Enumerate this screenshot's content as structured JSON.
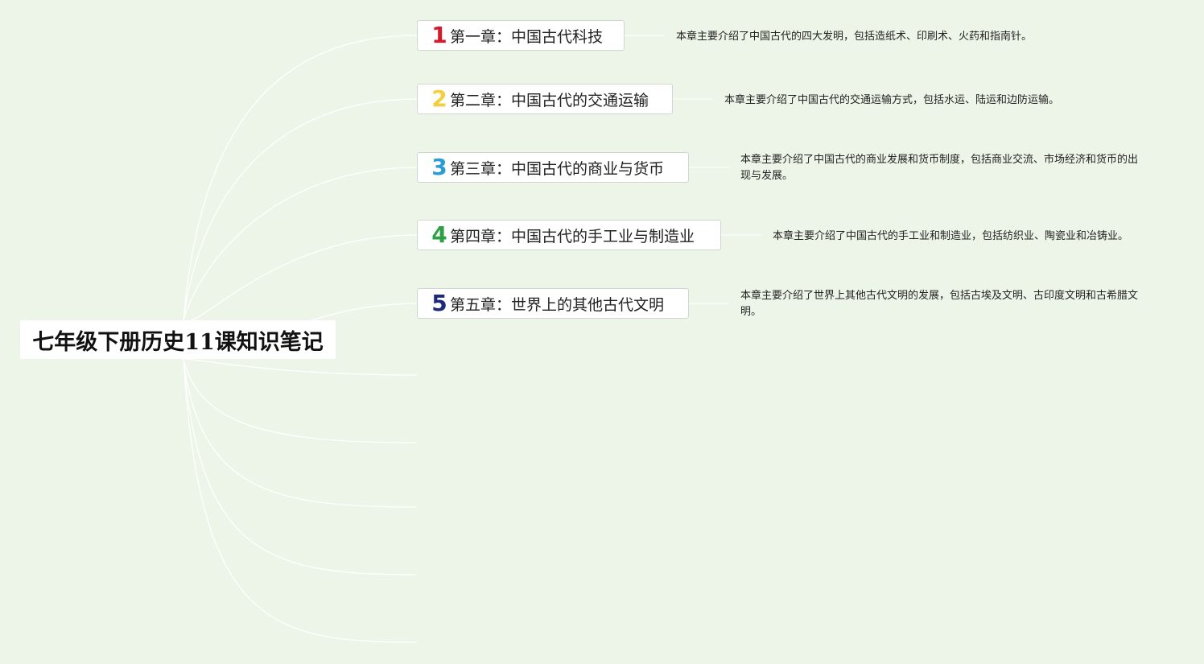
{
  "root": {
    "title": "七年级下册历史11课知识笔记"
  },
  "chapters": [
    {
      "number": "1",
      "title": "第一章：中国古代科技",
      "color": "#d61a2a",
      "description": "本章主要介绍了中国古代的四大发明，包括造纸术、印刷术、火药和指南针。"
    },
    {
      "number": "2",
      "title": "第二章：中国古代的交通运输",
      "color": "#f3cf3f",
      "description": "本章主要介绍了中国古代的交通运输方式，包括水运、陆运和边防运输。"
    },
    {
      "number": "3",
      "title": "第三章：中国古代的商业与货币",
      "color": "#2a9dd6",
      "description": "本章主要介绍了中国古代的商业发展和货币制度，包括商业交流、市场经济和货币的出现与发展。"
    },
    {
      "number": "4",
      "title": "第四章：中国古代的手工业与制造业",
      "color": "#2ea043",
      "description": "本章主要介绍了中国古代的手工业和制造业，包括纺织业、陶瓷业和冶铸业。"
    },
    {
      "number": "5",
      "title": "第五章：世界上的其他古代文明",
      "color": "#1d2a7a",
      "description": "本章主要介绍了世界上其他古代文明的发展，包括古埃及文明、古印度文明和古希腊文明。"
    }
  ],
  "colors": {
    "background": "#edf5e8",
    "connector": "#ffffff"
  }
}
